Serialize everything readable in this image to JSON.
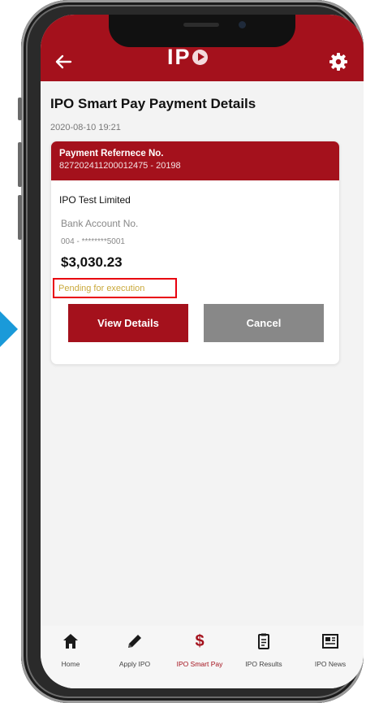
{
  "app": {
    "logo_text": "IP",
    "back_icon": "arrow-left-icon",
    "settings_icon": "gear-icon",
    "brand_color": "#a4111c"
  },
  "page": {
    "title": "IPO Smart Pay Payment Details",
    "timestamp": "2020-08-10 19:21"
  },
  "payment": {
    "ref_label": "Payment Refernece No.",
    "ref_value": "827202411200012475 - 20198",
    "company": "IPO Test Limited",
    "account_label": "Bank Account No.",
    "account_value": "004 - ********5001",
    "amount": "$3,030.23",
    "status": "Pending for execution",
    "status_color": "#c9a83a"
  },
  "actions": {
    "view_details": "View Details",
    "cancel": "Cancel"
  },
  "nav": {
    "items": [
      {
        "label": "Home",
        "icon": "home-icon"
      },
      {
        "label": "Apply IPO",
        "icon": "pencil-icon"
      },
      {
        "label": "IPO Smart Pay",
        "icon": "dollar-icon",
        "active": true
      },
      {
        "label": "IPO Results",
        "icon": "clipboard-icon"
      },
      {
        "label": "IPO News",
        "icon": "newspaper-icon"
      }
    ]
  }
}
